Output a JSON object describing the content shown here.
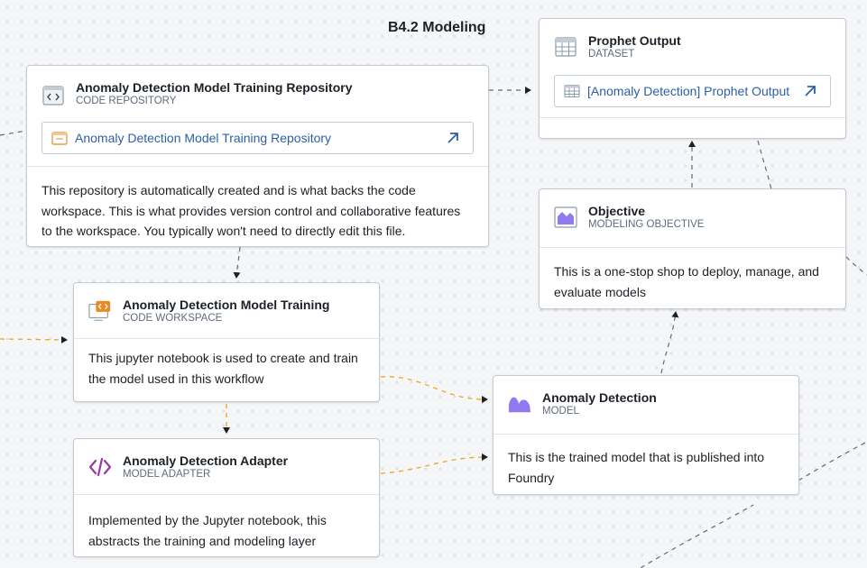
{
  "canvas": {
    "title": "B4.2 Modeling"
  },
  "colors": {
    "accent_link": "#2d5fa7",
    "edge_data": "#f0a420",
    "edge_dependency": "#5f6b7c",
    "model_purple": "#9179f2",
    "adapter_purple": "#9a38a5",
    "workspace_orange": "#e88b26"
  },
  "nodes": {
    "repository": {
      "title": "Anomaly Detection Model Training Repository",
      "type": "CODE REPOSITORY",
      "icon": "code-repository-icon",
      "link_text": "Anomaly Detection Model Training Repository",
      "description": "This repository is automatically created and is what backs the code workspace. This is what provides version control and collaborative features to the workspace. You typically won't need to directly edit this file."
    },
    "workspace": {
      "title": "Anomaly Detection Model Training",
      "type": "CODE WORKSPACE",
      "icon": "code-workspace-icon",
      "description": "This jupyter notebook is used to create and train the model used in this workflow"
    },
    "adapter": {
      "title": "Anomaly Detection Adapter",
      "type": "MODEL ADAPTER",
      "icon": "code-brackets-icon",
      "description": "Implemented by the Jupyter notebook, this abstracts the training and modeling layer"
    },
    "prophet_output": {
      "title": "Prophet Output",
      "type": "DATASET",
      "icon": "dataset-table-icon",
      "link_text": "[Anomaly Detection] Prophet Output"
    },
    "objective": {
      "title": "Objective",
      "type": "MODELING OBJECTIVE",
      "icon": "modeling-objective-icon",
      "description": "This is a one-stop shop to deploy, manage, and evaluate models"
    },
    "model": {
      "title": "Anomaly Detection",
      "type": "MODEL",
      "icon": "model-icon",
      "description": "This is the trained model that is published into Foundry"
    }
  }
}
